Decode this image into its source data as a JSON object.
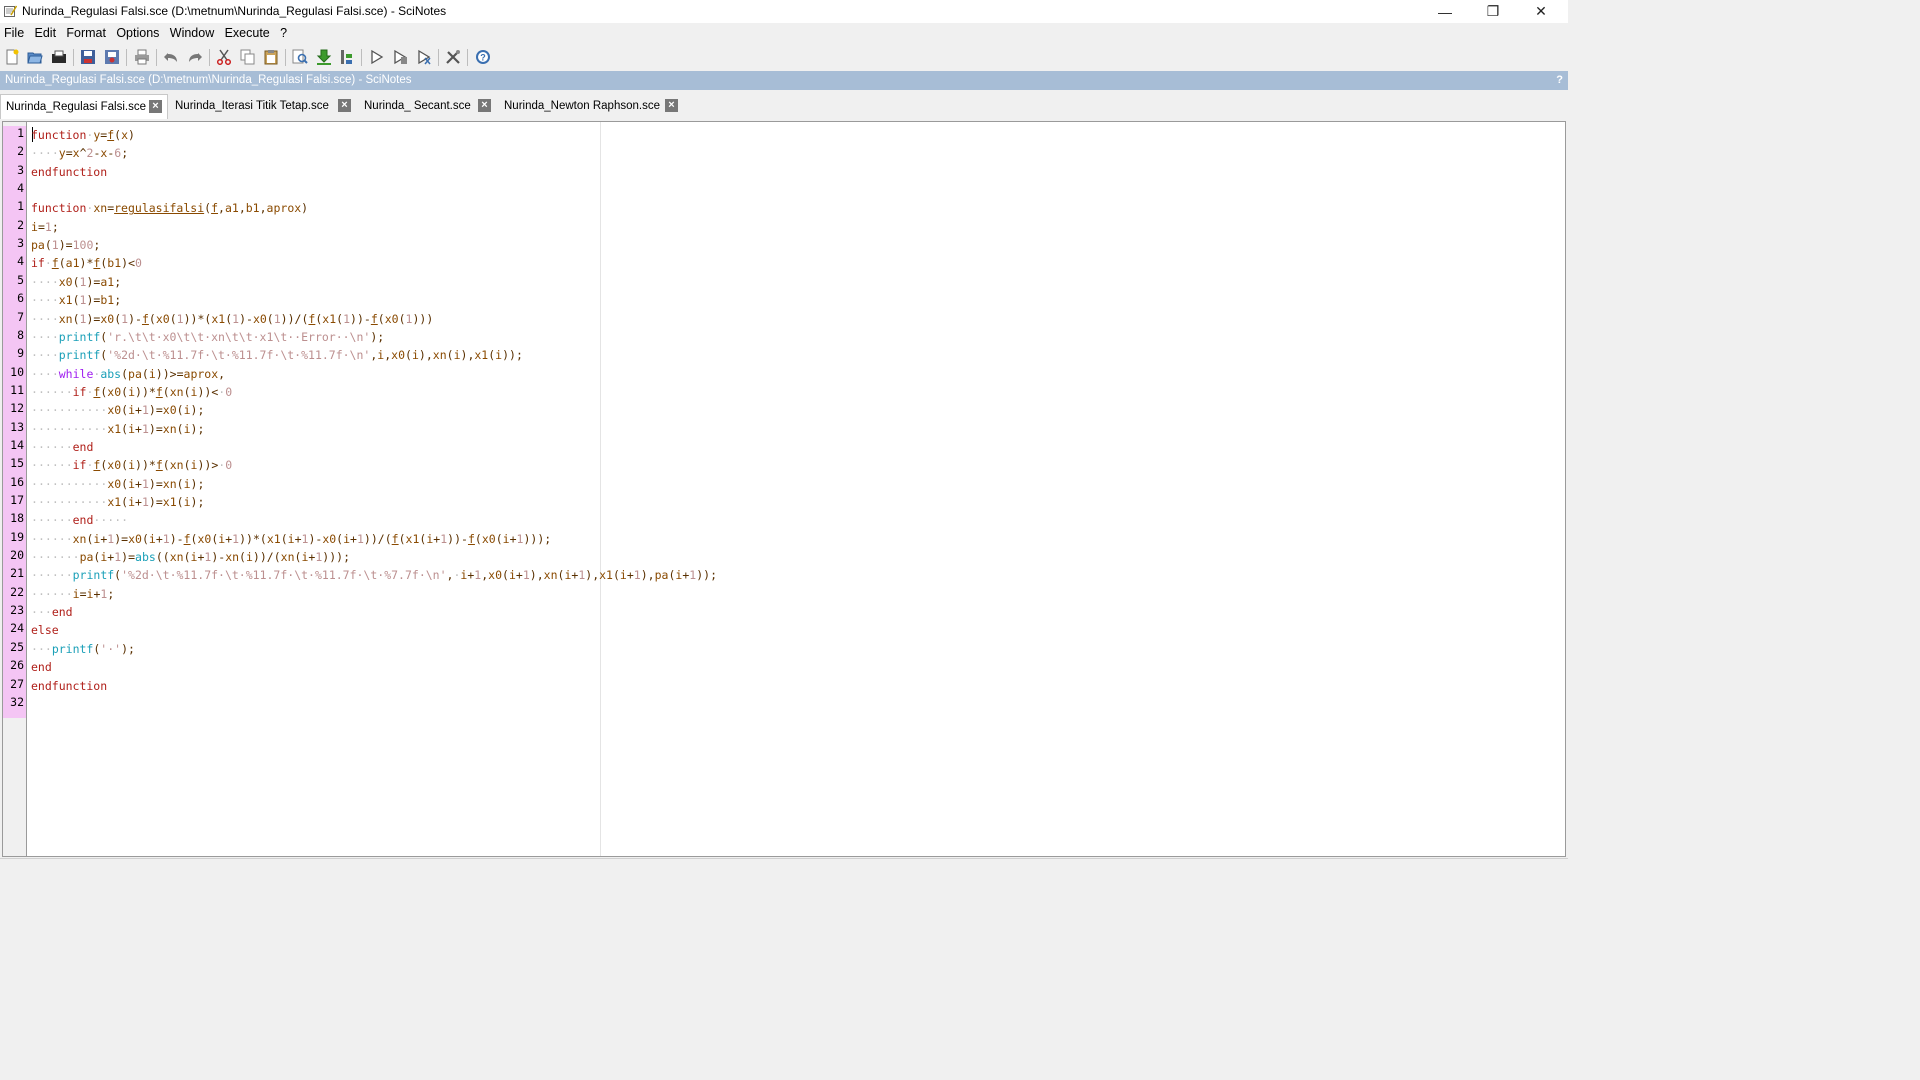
{
  "window": {
    "title": "Nurinda_Regulasi Falsi.sce (D:\\metnum\\Nurinda_Regulasi Falsi.sce) - SciNotes",
    "minimize": "—",
    "maximize": "❐",
    "close": "✕"
  },
  "menu": [
    "File",
    "Edit",
    "Format",
    "Options",
    "Window",
    "Execute",
    "?"
  ],
  "toolbar_icons": [
    "new-file-icon",
    "open-file-icon",
    "open-recent-icon",
    "save-icon",
    "save-all-icon",
    "print-icon",
    "undo-icon",
    "redo-icon",
    "cut-icon",
    "copy-icon",
    "paste-icon",
    "find-icon",
    "load-into-scilab-icon",
    "execute-file-icon",
    "run-icon",
    "run-selection-icon",
    "run-echo-icon",
    "preferences-icon",
    "help-icon"
  ],
  "infobar": {
    "text": "Nurinda_Regulasi Falsi.sce (D:\\metnum\\Nurinda_Regulasi Falsi.sce) - SciNotes",
    "help": "?"
  },
  "tabs": [
    {
      "label": "Nurinda_Regulasi Falsi.sce",
      "active": true
    },
    {
      "label": "Nurinda_Iterasi Titik Tetap.sce",
      "active": false
    },
    {
      "label": "Nurinda_ Secant.sce",
      "active": false
    },
    {
      "label": "Nurinda_Newton Raphson.sce",
      "active": false
    }
  ],
  "line_numbers": [
    "1",
    "2",
    "3",
    "4",
    "1",
    "2",
    "3",
    "4",
    "5",
    "6",
    "7",
    "8",
    "9",
    "10",
    "11",
    "12",
    "13",
    "14",
    "15",
    "16",
    "17",
    "18",
    "19",
    "20",
    "21",
    "22",
    "23",
    "24",
    "25",
    "26",
    "27",
    "32"
  ],
  "code_lines": [
    "function y=f(x)",
    "    y=x^2-x-6;",
    "endfunction",
    "",
    "function xn=regulasifalsi(f,a1,b1,aprox)",
    "i=1;",
    "pa(1)=100;",
    "if f(a1)*f(b1)<0",
    "    x0(1)=a1;",
    "    x1(1)=b1;",
    "    xn(1)=x0(1)-f(x0(1))*(x1(1)-x0(1))/(f(x1(1))-f(x0(1)))",
    "    printf('r.\\t\\t x0\\t\\t xn\\t\\t x1\\t  Error  \\n');",
    "    printf('%2d \\t %11.7f \\t %11.7f \\t %11.7f \\n',i,x0(i),xn(i),x1(i));",
    "    while abs(pa(i))>=aprox,",
    "      if f(x0(i))*f(xn(i))< 0",
    "           x0(i+1)=x0(i);",
    "           x1(i+1)=xn(i);",
    "      end",
    "      if f(x0(i))*f(xn(i))> 0",
    "           x0(i+1)=xn(i);",
    "           x1(i+1)=x1(i);",
    "      end     ",
    "      xn(i+1)=x0(i+1)-f(x0(i+1))*(x1(i+1)-x0(i+1))/(f(x1(i+1))-f(x0(i+1)));",
    "       pa(i+1)=abs((xn(i+1)-xn(i))/(xn(i+1)));",
    "      printf('%2d \\t %11.7f \\t %11.7f \\t %11.7f \\t %7.7f \\n', i+1,x0(i+1),xn(i+1),x1(i+1),pa(i+1));",
    "      i=i+1;",
    "   end",
    "else",
    "   printf(' ');",
    "end",
    "endfunction",
    ""
  ]
}
